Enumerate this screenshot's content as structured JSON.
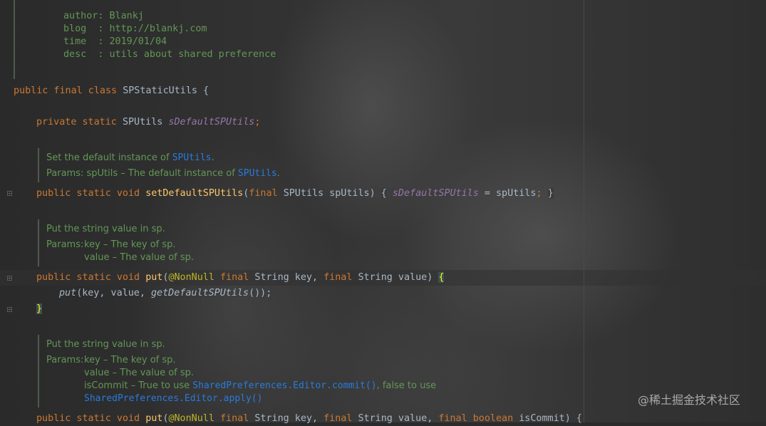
{
  "header_comment": [
    {
      "key": "author",
      "sep": ": ",
      "value": "Blankj"
    },
    {
      "key": "blog  ",
      "sep": ": ",
      "value": "http://blankj.com"
    },
    {
      "key": "time  ",
      "sep": ": ",
      "value": "2019/01/04"
    },
    {
      "key": "desc  ",
      "sep": ": ",
      "value": "utils about shared preference"
    }
  ],
  "class_decl": {
    "modifiers": "public final class ",
    "name": "SPStaticUtils",
    "brace": " {"
  },
  "field_decl": {
    "modifiers": "private static ",
    "type": "SPUtils ",
    "name": "sDefaultSPUtils",
    "semicolon": ";"
  },
  "doc1": {
    "summary_prefix": "Set the default instance of ",
    "summary_link": "SPUtils",
    "summary_suffix": ".",
    "params_prefix": "Params: spUtils – The default instance of ",
    "params_link": "SPUtils",
    "params_suffix": "."
  },
  "method1": {
    "modifiers": "public static void ",
    "name": "setDefaultSPUtils",
    "open": "(",
    "param_kw": "final ",
    "param": "SPUtils spUtils",
    "close": ") ",
    "body_open": "{",
    "space": " ",
    "field": "sDefaultSPUtils",
    "assign": " = spUtils",
    "semi": ";",
    "body_close": "}"
  },
  "doc2": {
    "summary": "Put the string value in sp.",
    "params_label": "Params:",
    "param1": "key – The key of sp.",
    "param2": "value – The value of sp."
  },
  "method2": {
    "modifiers": "public static void ",
    "name": "put",
    "open": "(",
    "annotation": "@NonNull",
    "kw1": " final ",
    "p1": "String key, ",
    "kw2": "final ",
    "p2": "String value",
    "close": ") ",
    "brace": "{",
    "body_call": "put",
    "body_args": "(key, value, ",
    "body_inner": "getDefaultSPUtils",
    "body_end": "());",
    "end_brace": "}"
  },
  "doc3": {
    "summary": "Put the string value in sp.",
    "params_label": "Params:",
    "param1": "key – The key of sp.",
    "param2": "value – The value of sp.",
    "param3_prefix": "isCommit – True to use ",
    "param3_link": "SharedPreferences.Editor.commit()",
    "param3_suffix": ", false to use",
    "param4_link": "SharedPreferences.Editor.apply()"
  },
  "method3": {
    "modifiers": "public static void ",
    "name": "put",
    "open": "(",
    "annotation": "@NonNull",
    "kw1": " final ",
    "p1": "String key, ",
    "kw2": "final ",
    "p2": "String value, ",
    "kw3": "final boolean ",
    "p3": "isCommit",
    "close": ") {"
  },
  "watermark": "@稀土掘金技术社区",
  "colors": {
    "background": "#2b2b2b",
    "keyword": "#cc7832",
    "plain": "#a9b7c6",
    "field": "#9876aa",
    "method": "#ffc66d",
    "annotation": "#bbb529",
    "comment": "#629755",
    "doc_link": "#287bde"
  }
}
